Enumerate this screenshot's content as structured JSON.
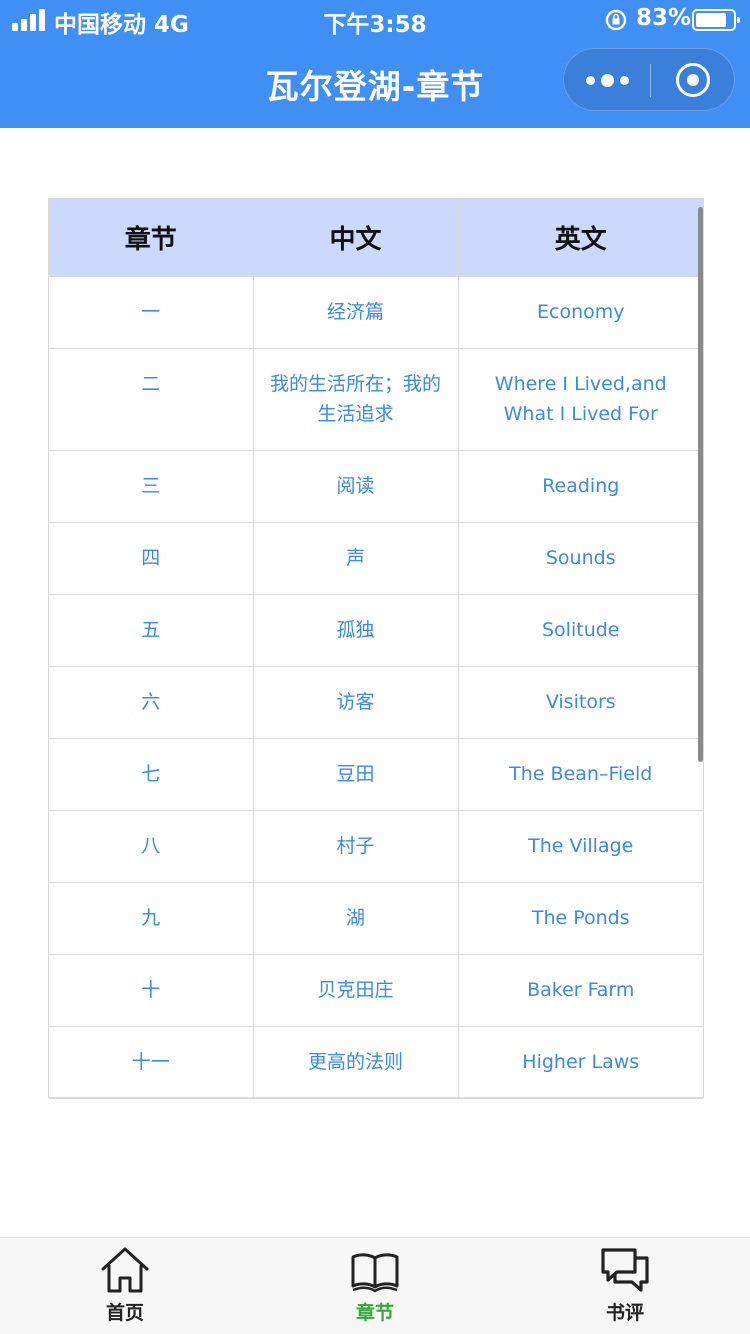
{
  "status_bar": {
    "carrier": "中国移动",
    "network": "4G",
    "time": "下午3:58",
    "battery_percent": "83%",
    "battery_level": 0.83
  },
  "nav": {
    "title": "瓦尔登湖-章节"
  },
  "table": {
    "headers": [
      "章节",
      "中文",
      "英文"
    ],
    "rows": [
      {
        "num": "一",
        "cn": "经济篇",
        "en": "Economy"
      },
      {
        "num": "二",
        "cn": "我的生活所在；我的生活追求",
        "en": "Where I Lived,and What I Lived For"
      },
      {
        "num": "三",
        "cn": "阅读",
        "en": "Reading"
      },
      {
        "num": "四",
        "cn": "声",
        "en": "Sounds"
      },
      {
        "num": "五",
        "cn": "孤独",
        "en": "Solitude"
      },
      {
        "num": "六",
        "cn": "访客",
        "en": "Visitors"
      },
      {
        "num": "七",
        "cn": "豆田",
        "en": "The Bean–Field"
      },
      {
        "num": "八",
        "cn": "村子",
        "en": "The Village"
      },
      {
        "num": "九",
        "cn": "湖",
        "en": "The Ponds"
      },
      {
        "num": "十",
        "cn": "贝克田庄",
        "en": "Baker Farm"
      },
      {
        "num": "十一",
        "cn": "更高的法则",
        "en": "Higher Laws"
      }
    ]
  },
  "tabbar": {
    "items": [
      {
        "label": "首页",
        "icon": "home-icon",
        "active": false
      },
      {
        "label": "章节",
        "icon": "book-icon",
        "active": true
      },
      {
        "label": "书评",
        "icon": "chat-icon",
        "active": false
      }
    ]
  },
  "colors": {
    "nav_bg": "#3f8ff5",
    "header_bg": "#cbdafc",
    "cell_text": "#3a8be6",
    "tab_active": "#35a837"
  }
}
